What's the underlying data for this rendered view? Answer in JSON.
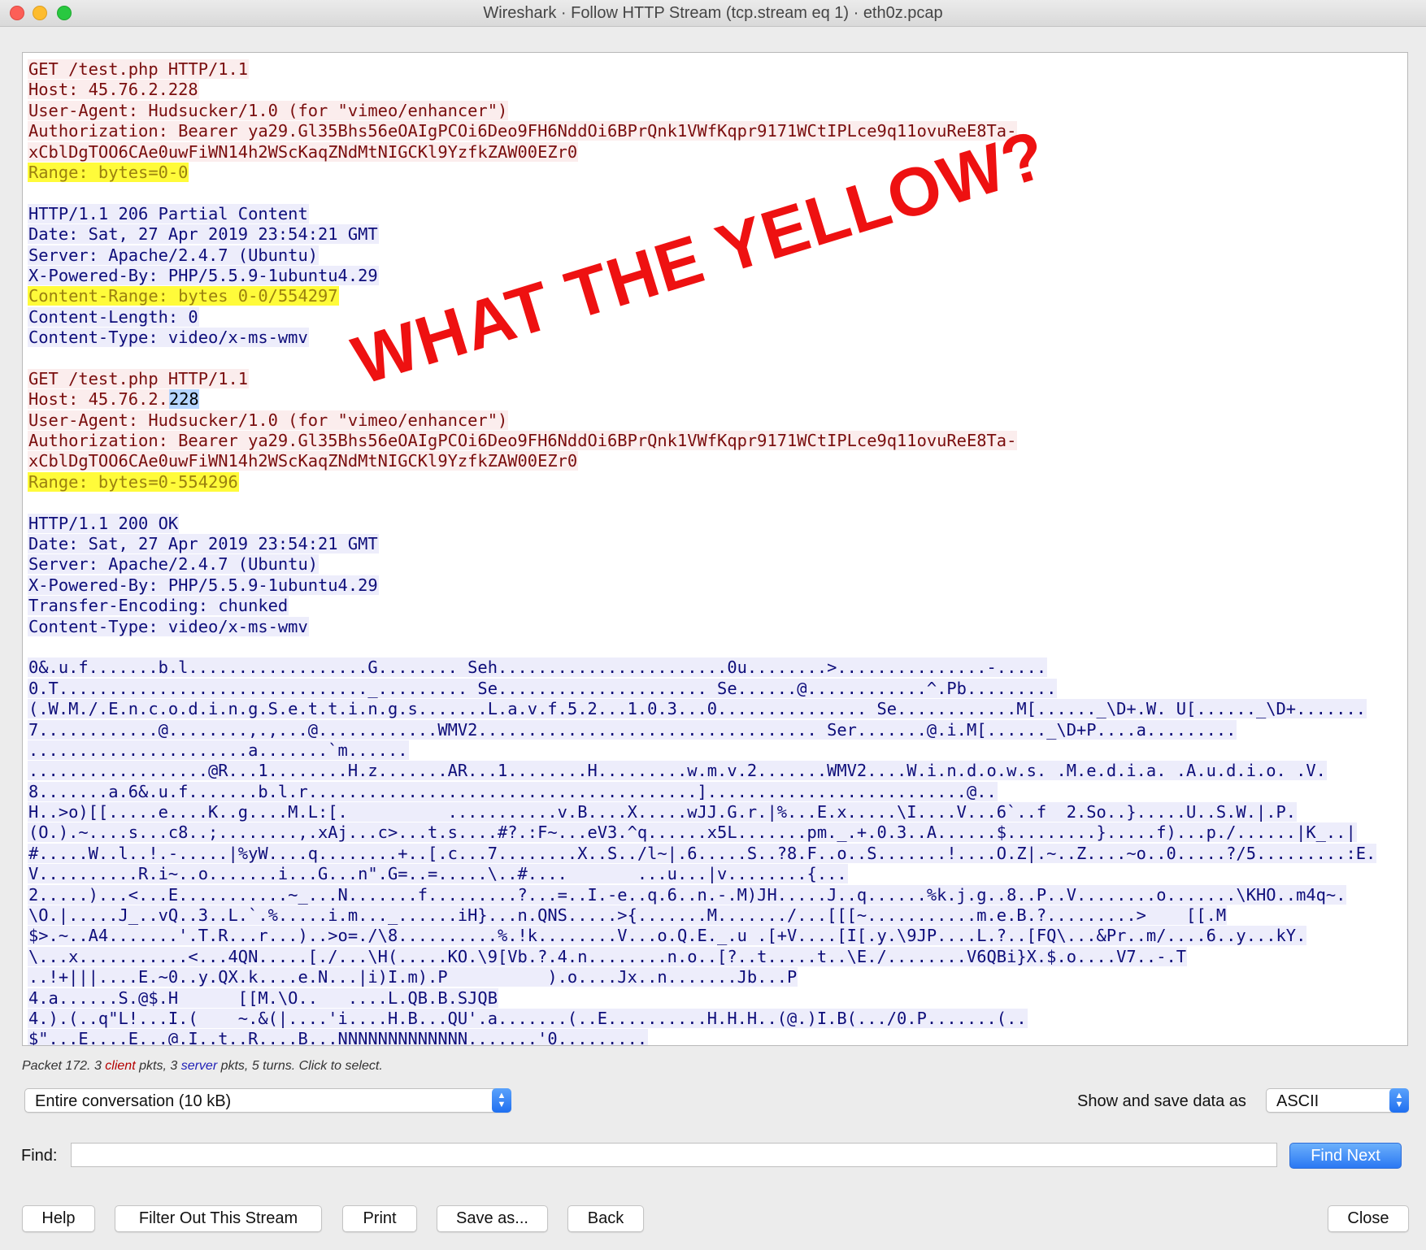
{
  "window": {
    "title": "Wireshark · Follow HTTP Stream (tcp.stream eq 1) · eth0z.pcap"
  },
  "stream": {
    "lines": [
      {
        "type": "client",
        "text": "GET /test.php HTTP/1.1"
      },
      {
        "type": "client",
        "text": "Host: 45.76.2.228"
      },
      {
        "type": "client",
        "text": "User-Agent: Hudsucker/1.0 (for \"vimeo/enhancer\")"
      },
      {
        "type": "client",
        "text": "Authorization: Bearer ya29.Gl35Bhs56eOAIgPCOi6Deo9FH6NddOi6BPrQnk1VWfKqpr9171WCtIPLce9q11ovuReE8Ta-"
      },
      {
        "type": "client",
        "text": "xCblDgTOO6CAe0uwFiWN14h2WScKaqZNdMtNIGCKl9YzfkZAW00EZr0"
      },
      {
        "type": "client-hl",
        "text": "Range: bytes=0-0"
      },
      {
        "type": "blank",
        "text": ""
      },
      {
        "type": "server",
        "text": "HTTP/1.1 206 Partial Content"
      },
      {
        "type": "server",
        "text": "Date: Sat, 27 Apr 2019 23:54:21 GMT"
      },
      {
        "type": "server",
        "text": "Server: Apache/2.4.7 (Ubuntu)"
      },
      {
        "type": "server",
        "text": "X-Powered-By: PHP/5.5.9-1ubuntu4.29"
      },
      {
        "type": "server-hl",
        "text": "Content-Range: bytes 0-0/554297"
      },
      {
        "type": "server",
        "text": "Content-Length: 0"
      },
      {
        "type": "server",
        "text": "Content-Type: video/x-ms-wmv"
      },
      {
        "type": "blank",
        "text": ""
      },
      {
        "type": "client",
        "text": "GET /test.php HTTP/1.1"
      },
      {
        "type": "client-sel",
        "text": "Host: 45.76.2.",
        "sel": "228"
      },
      {
        "type": "client",
        "text": "User-Agent: Hudsucker/1.0 (for \"vimeo/enhancer\")"
      },
      {
        "type": "client",
        "text": "Authorization: Bearer ya29.Gl35Bhs56eOAIgPCOi6Deo9FH6NddOi6BPrQnk1VWfKqpr9171WCtIPLce9q11ovuReE8Ta-"
      },
      {
        "type": "client",
        "text": "xCblDgTOO6CAe0uwFiWN14h2WScKaqZNdMtNIGCKl9YzfkZAW00EZr0"
      },
      {
        "type": "client-hl",
        "text": "Range: bytes=0-554296"
      },
      {
        "type": "blank",
        "text": ""
      },
      {
        "type": "server",
        "text": "HTTP/1.1 200 OK"
      },
      {
        "type": "server",
        "text": "Date: Sat, 27 Apr 2019 23:54:21 GMT"
      },
      {
        "type": "server",
        "text": "Server: Apache/2.4.7 (Ubuntu)"
      },
      {
        "type": "server",
        "text": "X-Powered-By: PHP/5.5.9-1ubuntu4.29"
      },
      {
        "type": "server",
        "text": "Transfer-Encoding: chunked"
      },
      {
        "type": "server",
        "text": "Content-Type: video/x-ms-wmv"
      },
      {
        "type": "blank",
        "text": ""
      },
      {
        "type": "binary",
        "text": "0&.u.f.......b.l..................G........ Seh.......................0u........>...............-....."
      },
      {
        "type": "binary",
        "text": "0.T..............................._......... Se..................... Se......@............^.Pb........."
      },
      {
        "type": "binary",
        "text": "(.W.M./.E.n.c.o.d.i.n.g.S.e.t.t.i.n.g.s.......L.a.v.f.5.2...1.0.3...0............... Se............M[......_\\D+.W. U[......_\\D+......."
      },
      {
        "type": "binary",
        "text": "7............@........,.,...@............WMV2.................................. Ser.......@.i.M[......_\\D+P....a........."
      },
      {
        "type": "binary",
        "text": "......................a.......`m......"
      },
      {
        "type": "binary",
        "text": "..................@R...1........H.z.......AR...1........H.........w.m.v.2.......WMV2....W.i.n.d.o.w.s. .M.e.d.i.a. .A.u.d.i.o. .V."
      },
      {
        "type": "binary",
        "text": "8.......a.6&.u.f.......b.l.r.......................................]..........................@.."
      },
      {
        "type": "binary",
        "text": "H..>o)[[.....e....K..g....M.L:[.          ...........v.B....X.....wJJ.G.r.|%...E.x.....\\I....V...6`..f  2.So..}.....U..S.W.|.P."
      },
      {
        "type": "binary",
        "text": "(O.).~....s...c8..;........,.xAj...c>...t.s....#?.:F~...eV3.^q......x5L.......pm._.+.0.3..A......$.........}.....f)...p./......|K_..|"
      },
      {
        "type": "binary",
        "text": "#.....W..l..!.-.....|%yW....q........+..[.c...7........X..S../l~|.6.....S..?8.F..o..S.......!....O.Z|.~..Z....~o..0.....?/5.........:E."
      },
      {
        "type": "binary",
        "text": "V..........R.i~..o.......i...G...n\".G=..=.....\\..#....       ...u...|v........{..."
      },
      {
        "type": "binary",
        "text": "2.....)...<...E...........~_...N.......f.........?...=..I.-e..q.6..n.-.M)JH.....J..q......%k.j.g..8..P..V........o.......\\KHO..m4q~."
      },
      {
        "type": "binary",
        "text": "\\O.|.....J_..vQ..3..L.`.%.....i.m..._......iH}...n.QNS.....>{.......M......./...[[[~...........m.e.B.?.........>    [[.M"
      },
      {
        "type": "binary",
        "text": "$>.~..A4.......'.T.R...r...)..>o=./\\8..........%.!k........V...o.Q.E._.u .[+V....[I[.y.\\9JP....L.?..[FQ\\...&Pr..m/....6..y...kY."
      },
      {
        "type": "binary",
        "text": "\\...x...........<...4QN.....[./...\\H(.....KO.\\9[Vb.?.4.n........n.o..[?..t.....t..\\E./........V6QBi}X.$.o....V7..-.T"
      },
      {
        "type": "binary",
        "text": "..!+|||....E.~0..y.QX.k....e.N...|i)I.m).P          ).o....Jx..n.......Jb...P"
      },
      {
        "type": "binary",
        "text": "4.a......S.@$.H      [[M.\\O..   ....L.QB.B.SJQB"
      },
      {
        "type": "binary",
        "text": "4.).(..q\"L!...I.(    ~.&(|....'i....H.B...QU'.a.......(..E..........H.H.H..(@.)I.B(.../0.P.......(.."
      },
      {
        "type": "binary",
        "text": "$\"...E....E...@.I..t..R....B...NNNNNNNNNNNNN.......'0........."
      }
    ],
    "overlay_text": "WHAT THE YELLOW?"
  },
  "packet_info": {
    "prefix": "Packet 172. 3 ",
    "client_word": "client",
    "middle": " pkts, 3 ",
    "server_word": "server",
    "suffix": " pkts, 5 turns. Click to select."
  },
  "controls": {
    "conversation_select": "Entire conversation (10 kB)",
    "show_save_label": "Show and save data as",
    "format_select": "ASCII",
    "find_label": "Find:",
    "find_value": "",
    "find_next": "Find Next"
  },
  "buttons": {
    "help": "Help",
    "filter_out": "Filter Out This Stream",
    "print": "Print",
    "save_as": "Save as...",
    "back": "Back",
    "close": "Close"
  },
  "colors": {
    "client_fg": "#7a0e0e",
    "client_bg": "#fbeded",
    "server_fg": "#0e0e7a",
    "server_bg": "#ededfb",
    "highlight_bg": "#fffb3a",
    "overlay": "#ee1111",
    "accent": "#2a78f3"
  }
}
